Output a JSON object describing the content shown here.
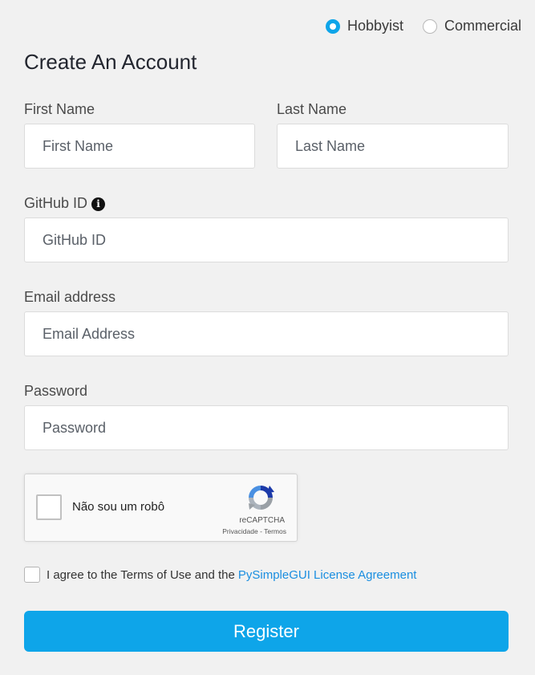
{
  "account_type": {
    "options": [
      {
        "label": "Hobbyist",
        "selected": true
      },
      {
        "label": "Commercial",
        "selected": false
      }
    ]
  },
  "title": "Create An Account",
  "fields": {
    "first_name": {
      "label": "First Name",
      "placeholder": "First Name",
      "value": ""
    },
    "last_name": {
      "label": "Last Name",
      "placeholder": "Last Name",
      "value": ""
    },
    "github_id": {
      "label": "GitHub ID",
      "placeholder": "GitHub ID",
      "value": "",
      "info_icon": "info-icon"
    },
    "email": {
      "label": "Email address",
      "placeholder": "Email Address",
      "value": ""
    },
    "password": {
      "label": "Password",
      "placeholder": "Password",
      "value": ""
    }
  },
  "captcha": {
    "checkbox_label": "Não sou um robô",
    "brand": "reCAPTCHA",
    "privacy": "Privacidade",
    "separator": "-",
    "terms": "Termos",
    "checked": false
  },
  "agreement": {
    "text": "I agree to the Terms of Use and the",
    "link_text": "PySimpleGUI License Agreement",
    "checked": false
  },
  "register_label": "Register",
  "colors": {
    "accent": "#0ea5e9",
    "link": "#1a8ee0",
    "background": "#f1f1f1"
  }
}
